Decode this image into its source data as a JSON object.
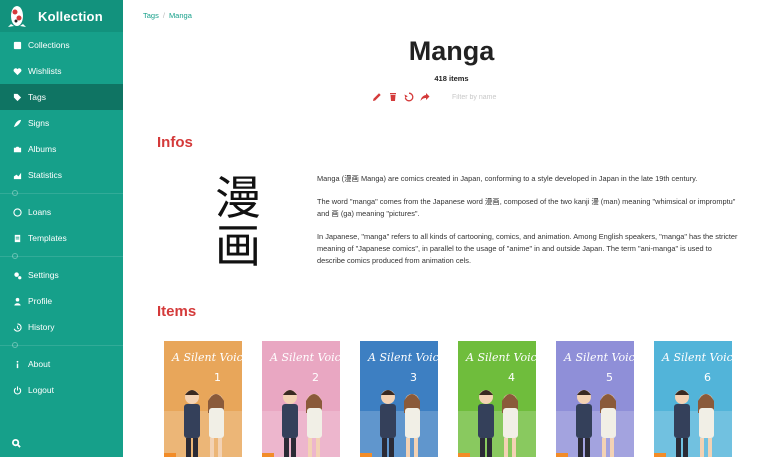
{
  "app": {
    "brand": "Kollection"
  },
  "sidebar": {
    "items": [
      {
        "label": "Collections",
        "icon": "collections-icon"
      },
      {
        "label": "Wishlists",
        "icon": "heart-icon"
      },
      {
        "label": "Tags",
        "icon": "tags-icon",
        "active": true
      },
      {
        "label": "Signs",
        "icon": "signs-icon"
      },
      {
        "label": "Albums",
        "icon": "camera-icon"
      },
      {
        "label": "Statistics",
        "icon": "chart-icon"
      },
      {
        "label": "Loans",
        "icon": "loans-icon"
      },
      {
        "label": "Templates",
        "icon": "templates-icon"
      },
      {
        "label": "Settings",
        "icon": "gears-icon"
      },
      {
        "label": "Profile",
        "icon": "user-icon"
      },
      {
        "label": "History",
        "icon": "history-icon"
      },
      {
        "label": "About",
        "icon": "info-icon"
      },
      {
        "label": "Logout",
        "icon": "power-icon"
      }
    ]
  },
  "breadcrumb": {
    "parent": "Tags",
    "separator": "/",
    "current": "Manga"
  },
  "header": {
    "title": "Manga",
    "count": "418 items",
    "filter_placeholder": "Filter by name"
  },
  "infos": {
    "title": "Infos",
    "image_text": "漫画",
    "paragraphs": [
      "Manga (漫画 Manga) are comics created in Japan, conforming to a style developed in Japan in the late 19th century.",
      "The word \"manga\" comes from the Japanese word 漫画, composed of the two kanji 漫 (man) meaning \"whimsical or impromptu\" and 画 (ga) meaning \"pictures\".",
      "In Japanese, \"manga\" refers to all kinds of cartooning, comics, and animation. Among English speakers, \"manga\" has the stricter meaning of \"Japanese comics\", in parallel to the usage of \"anime\" in and outside Japan. The term \"ani-manga\" is used to describe comics produced from animation cels."
    ]
  },
  "items": {
    "title": "Items",
    "covers": [
      {
        "title": "A Silent Voice",
        "volume": "1",
        "bg": "#e8a65a"
      },
      {
        "title": "A Silent Voice",
        "volume": "2",
        "bg": "#e9a7c2"
      },
      {
        "title": "A Silent Voice",
        "volume": "3",
        "bg": "#3d7fc2"
      },
      {
        "title": "A Silent Voice",
        "volume": "4",
        "bg": "#6fbd3c"
      },
      {
        "title": "A Silent Voice",
        "volume": "5",
        "bg": "#8f8fd8"
      },
      {
        "title": "A Silent Voice",
        "volume": "6",
        "bg": "#52b4d9"
      }
    ]
  },
  "colors": {
    "accent": "#16a08a",
    "accent_dark": "#0f7463",
    "red": "#d43a3a"
  }
}
